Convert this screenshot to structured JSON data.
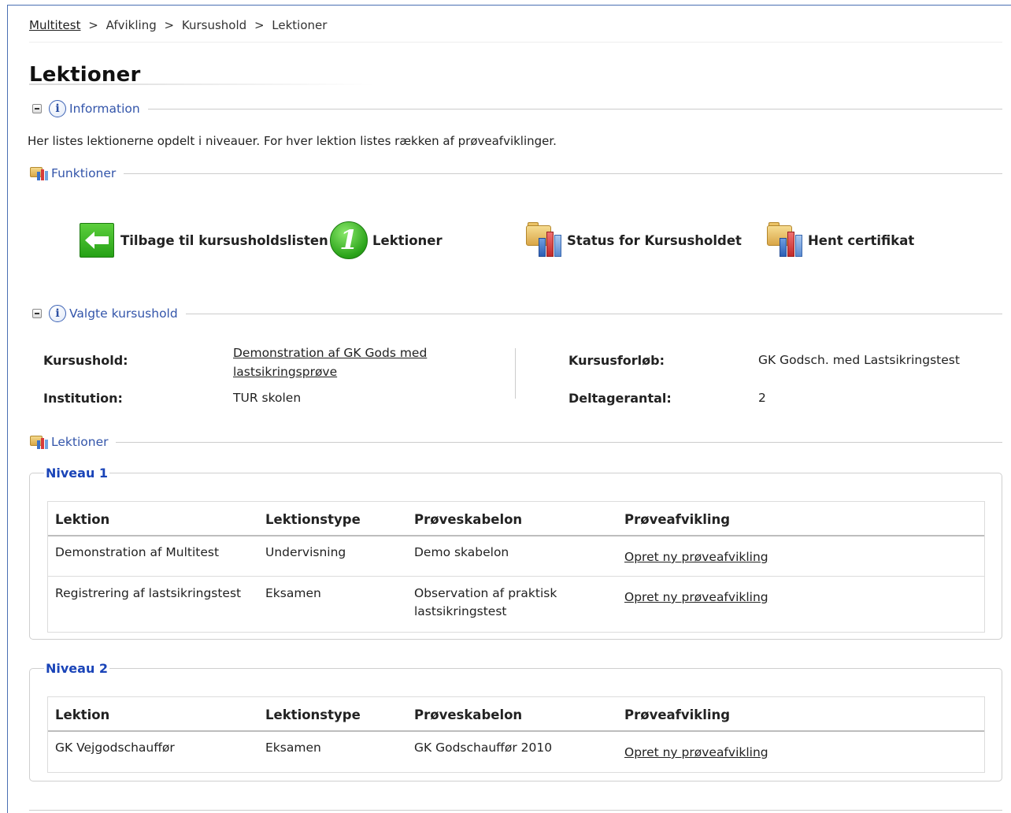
{
  "breadcrumb": {
    "items": [
      "Multitest",
      "Afvikling",
      "Kursushold",
      "Lektioner"
    ],
    "separator": ">"
  },
  "page_title": "Lektioner",
  "information": {
    "section_label": "Information",
    "text": "Her listes lektionerne opdelt i niveauer. For hver lektion listes rækken af prøveafviklinger."
  },
  "functions": {
    "section_label": "Funktioner",
    "buttons": {
      "back": "Tilbage til kursusholdslisten",
      "lessons": "Lektioner",
      "lessons_icon_text": "1",
      "status": "Status for Kursusholdet",
      "certificate": "Hent certifikat"
    }
  },
  "selected": {
    "section_label": "Valgte kursushold",
    "kursushold_label": "Kursushold:",
    "kursushold_value_line1": "Demonstration af GK Gods med",
    "kursushold_value_line2": "lastsikringsprøve",
    "institution_label": "Institution:",
    "institution_value": "TUR skolen",
    "kursusforloeb_label": "Kursusforløb:",
    "kursusforloeb_value": "GK Godsch. med Lastsikringstest",
    "deltagerantal_label": "Deltagerantal:",
    "deltagerantal_value": "2"
  },
  "lessons": {
    "section_label": "Lektioner",
    "columns": [
      "Lektion",
      "Lektionstype",
      "Prøveskabelon",
      "Prøveafvikling"
    ],
    "levels": [
      {
        "title": "Niveau 1",
        "rows": [
          {
            "lektion": "Demonstration af Multitest",
            "type": "Undervisning",
            "skabelon_line1": "Demo skabelon",
            "skabelon_line2": "",
            "afvikling": "Opret ny prøveafvikling"
          },
          {
            "lektion": "Registrering af lastsikringstest",
            "type": "Eksamen",
            "skabelon_line1": "Observation af praktisk",
            "skabelon_line2": "lastsikringstest",
            "afvikling": "Opret ny prøveafvikling"
          }
        ]
      },
      {
        "title": "Niveau 2",
        "rows": [
          {
            "lektion": "GK Vejgodschauffør",
            "type": "Eksamen",
            "skabelon_line1": "GK Godschauffør 2010",
            "skabelon_line2": "",
            "afvikling": "Opret ny prøveafvikling"
          }
        ]
      }
    ]
  },
  "colors": {
    "accent_blue": "#3355aa",
    "legend_blue": "#1a44b8",
    "button_green": "#26a116",
    "frame_border": "#4a6fb3"
  }
}
